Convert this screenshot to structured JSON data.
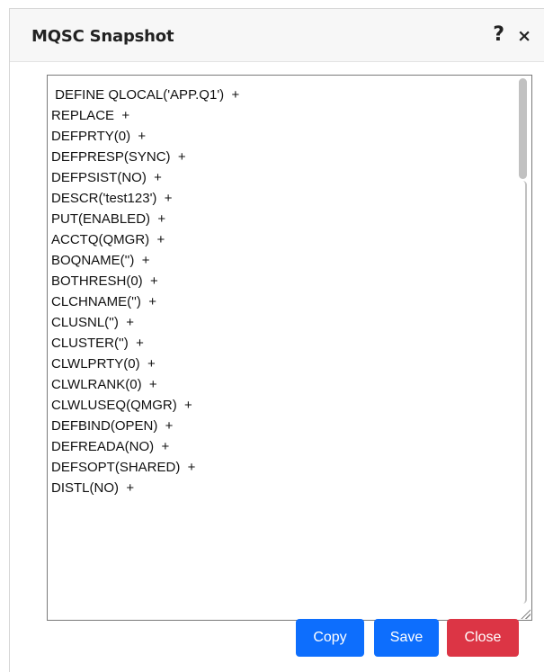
{
  "dialog": {
    "title": "MQSC Snapshot",
    "help_icon": "?",
    "close_icon": "×"
  },
  "editor": {
    "lines": [
      " DEFINE QLOCAL('APP.Q1')  +",
      "REPLACE  +",
      "DEFPRTY(0)  +",
      "DEFPRESP(SYNC)  +",
      "DEFPSIST(NO)  +",
      "DESCR('test123')  +",
      "PUT(ENABLED)  +",
      "ACCTQ(QMGR)  +",
      "BOQNAME('')  +",
      "BOTHRESH(0)  +",
      "CLCHNAME('')  +",
      "CLUSNL('')  +",
      "CLUSTER('')  +",
      "CLWLPRTY(0)  +",
      "CLWLRANK(0)  +",
      "CLWLUSEQ(QMGR)  +",
      "DEFBIND(OPEN)  +",
      "DEFREADA(NO)  +",
      "DEFSOPT(SHARED)  +",
      "DISTL(NO)  +"
    ]
  },
  "buttons": {
    "copy": "Copy",
    "save": "Save",
    "close": "Close"
  },
  "colors": {
    "primary": "#0d6efd",
    "danger": "#dc3545",
    "header_bg": "#f7f7f7"
  }
}
